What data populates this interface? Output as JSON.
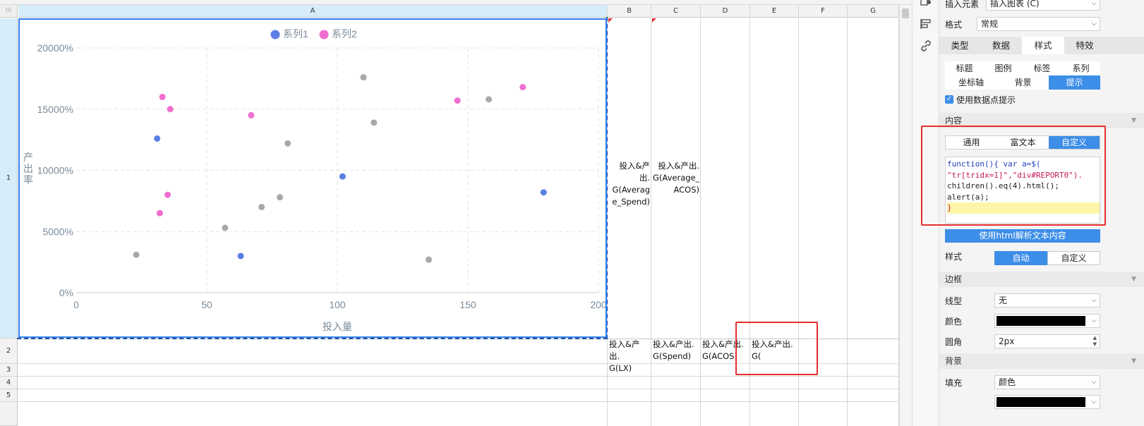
{
  "sheet": {
    "corner_glyph": "⁝⁝⁝",
    "columns": [
      "A",
      "B",
      "C",
      "D",
      "E",
      "F",
      "G"
    ],
    "rows": [
      "1",
      "2",
      "3",
      "4",
      "5"
    ],
    "cells": {
      "B1": "投入&产出.\nG(Averag\ne_Spend)",
      "C1": "投入&产出.\nG(Average_\nACOS)",
      "B2": "投入&产出.\nG(LX)",
      "C2": "投入&产出.\nG(Spend)",
      "D2": "投入&产出.\nG(ACOS)",
      "E2": "投入&产出.\nG("
    }
  },
  "chart": {
    "legend": [
      {
        "name": "系列1",
        "color": "#5b7ee5"
      },
      {
        "name": "系列2",
        "color": "#f06fd0"
      }
    ]
  },
  "chart_data": {
    "type": "scatter",
    "title": "",
    "xlabel": "投入量",
    "ylabel": "产出率",
    "xlim": [
      0,
      200
    ],
    "ylim": [
      0,
      20000
    ],
    "x_ticks": [
      "0",
      "50",
      "100",
      "150",
      "200"
    ],
    "y_ticks": [
      "0%",
      "5000%",
      "10000%",
      "15000%",
      "20000%"
    ],
    "grid": true,
    "legend_position": "top-center",
    "series": [
      {
        "name": "系列1",
        "color": "#5b7ee5",
        "points": [
          [
            31,
            12600
          ],
          [
            63,
            3000
          ],
          [
            102,
            9500
          ],
          [
            179,
            8200
          ]
        ]
      },
      {
        "name": "系列2",
        "color": "#f06fd0",
        "points": [
          [
            33,
            16000
          ],
          [
            36,
            15000
          ],
          [
            67,
            14500
          ],
          [
            35,
            8000
          ],
          [
            32,
            6500
          ],
          [
            146,
            15700
          ],
          [
            171,
            16800
          ]
        ]
      },
      {
        "name": "",
        "color": "#a8a8a8",
        "points": [
          [
            23,
            3100
          ],
          [
            57,
            5300
          ],
          [
            71,
            7000
          ],
          [
            78,
            7800
          ],
          [
            81,
            12200
          ],
          [
            110,
            17600
          ],
          [
            114,
            13900
          ],
          [
            135,
            2700
          ],
          [
            158,
            15800
          ]
        ]
      }
    ]
  },
  "panel": {
    "insert_label": "插入元素",
    "insert_value": "插入图表 (C)",
    "format_label": "格式",
    "format_value": "常规",
    "main_tabs": [
      "类型",
      "数据",
      "样式",
      "特效"
    ],
    "sub_tabs_row1": [
      "标题",
      "图例",
      "标签",
      "系列"
    ],
    "sub_tabs_row2": [
      "坐标轴",
      "背景",
      "提示"
    ],
    "use_point_tip": "使用数据点提示",
    "content_section": "内容",
    "content_tabs": [
      "通用",
      "富文本",
      "自定义"
    ],
    "code_lines": [
      "function(){ var a=$(",
      "\"tr[tridx=1]\",\"div#REPORT0\").",
      "children().eq(4).html();",
      "alert(a);",
      "}"
    ],
    "html_button": "使用html解析文本内容",
    "style_label": "样式",
    "style_options": [
      "自动",
      "自定义"
    ],
    "border_section": "边框",
    "line_type_label": "线型",
    "line_type_value": "无",
    "color_label": "颜色",
    "color_value": "#000000",
    "radius_label": "圆角",
    "radius_value": "2px",
    "bg_section": "背景",
    "fill_label": "填充",
    "fill_value": "颜色",
    "fill_color_value": "#000000"
  }
}
